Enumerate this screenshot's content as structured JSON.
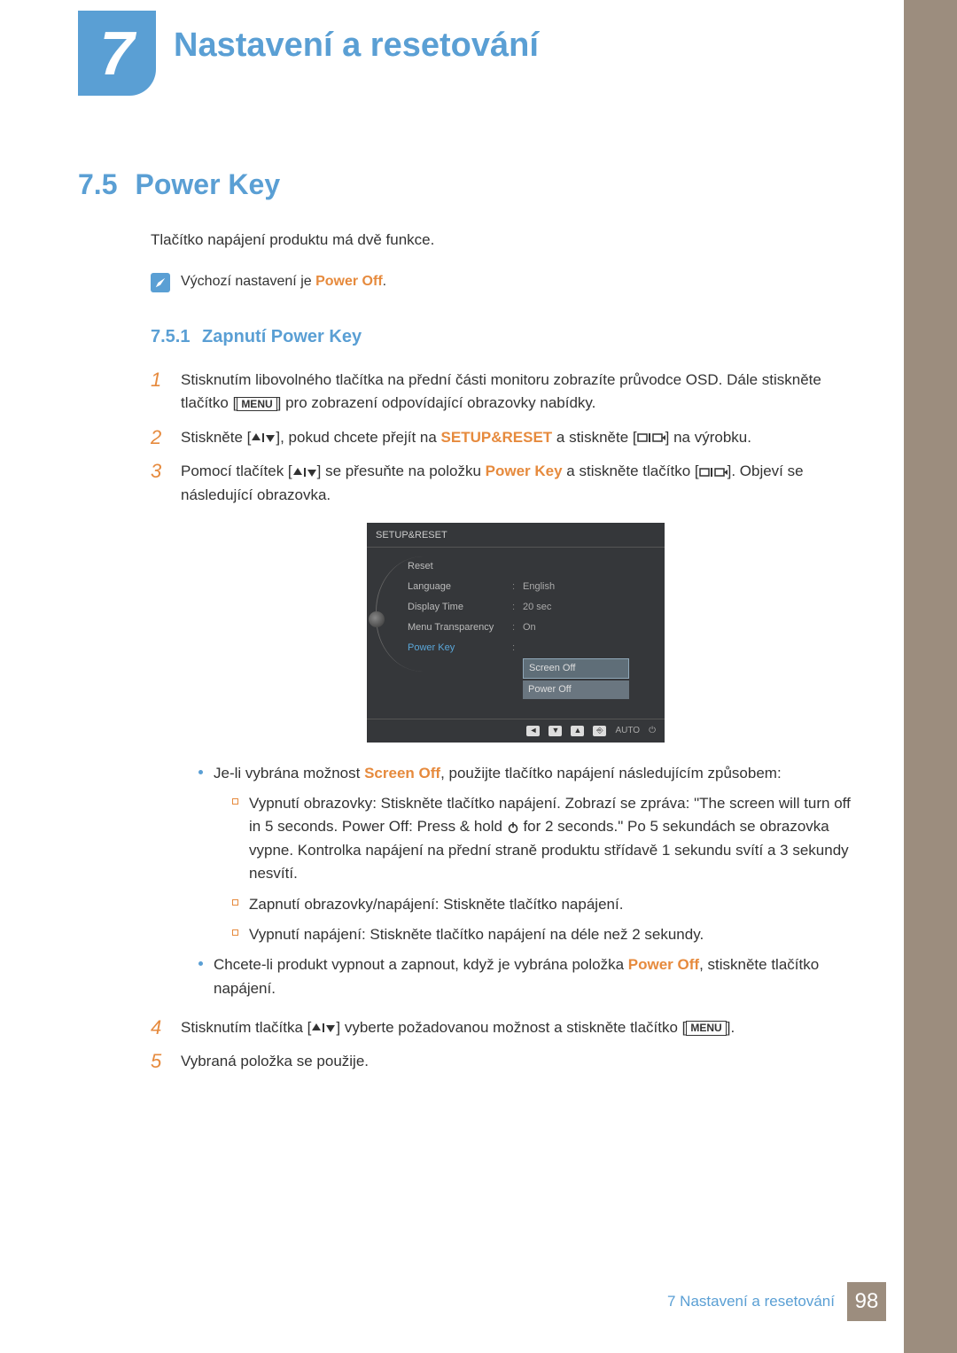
{
  "chapter": {
    "number": "7",
    "title": "Nastavení a resetování"
  },
  "section": {
    "number": "7.5",
    "title": "Power Key"
  },
  "intro": "Tlačítko napájení produktu má dvě funkce.",
  "note": {
    "prefix": "Výchozí nastavení je ",
    "highlight": "Power Off",
    "suffix": "."
  },
  "subsection": {
    "number": "7.5.1",
    "title": "Zapnutí Power Key"
  },
  "steps": {
    "s1": {
      "num": "1",
      "t1": "Stisknutím libovolného tlačítka na přední části monitoru zobrazíte průvodce OSD. Dále stiskněte tlačítko [",
      "menu": "MENU",
      "t2": "] pro zobrazení odpovídající obrazovky nabídky."
    },
    "s2": {
      "num": "2",
      "t1": "Stiskněte [",
      "t2": "], pokud chcete přejít na ",
      "hl": "SETUP&RESET",
      "t3": " a stiskněte [",
      "t4": "] na výrobku."
    },
    "s3": {
      "num": "3",
      "t1": "Pomocí tlačítek [",
      "t2": "] se přesuňte na položku ",
      "hl": "Power Key",
      "t3": " a stiskněte tlačítko [",
      "t4": "]. Objeví se následující obrazovka."
    },
    "s4": {
      "num": "4",
      "t1": "Stisknutím tlačítka [",
      "t2": "] vyberte požadovanou možnost a stiskněte tlačítko [",
      "menu": "MENU",
      "t3": "]."
    },
    "s5": {
      "num": "5",
      "t1": "Vybraná položka se použije."
    }
  },
  "bullets": {
    "b1": {
      "t1": "Je-li vybrána možnost ",
      "hl": "Screen Off",
      "t2": ", použijte tlačítko napájení následujícím způsobem:"
    },
    "b1a": {
      "t1": "Vypnutí obrazovky: Stiskněte tlačítko napájení. Zobrazí se zpráva: \"The screen will turn off in 5 seconds. Power Off: Press & hold ",
      "t2": " for 2 seconds.\" Po 5 sekundách se obrazovka vypne. Kontrolka napájení na přední straně produktu střídavě 1 sekundu svítí a 3 sekundy nesvítí."
    },
    "b1b": "Zapnutí obrazovky/napájení: Stiskněte tlačítko napájení.",
    "b1c": "Vypnutí napájení: Stiskněte tlačítko napájení na déle než 2 sekundy.",
    "b2": {
      "t1": "Chcete-li produkt vypnout a zapnout, když je vybrána položka ",
      "hl": "Power Off",
      "t2": ", stiskněte tlačítko napájení."
    }
  },
  "osd": {
    "title": "SETUP&RESET",
    "rows": {
      "reset": "Reset",
      "language": "Language",
      "language_val": "English",
      "display_time": "Display Time",
      "display_time_val": "20 sec",
      "transparency": "Menu Transparency",
      "transparency_val": "On",
      "power_key": "Power Key"
    },
    "options": {
      "screen_off": "Screen Off",
      "power_off": "Power Off"
    },
    "footer": {
      "auto": "AUTO"
    }
  },
  "footer": {
    "text": "7 Nastavení a resetování",
    "page": "98"
  }
}
